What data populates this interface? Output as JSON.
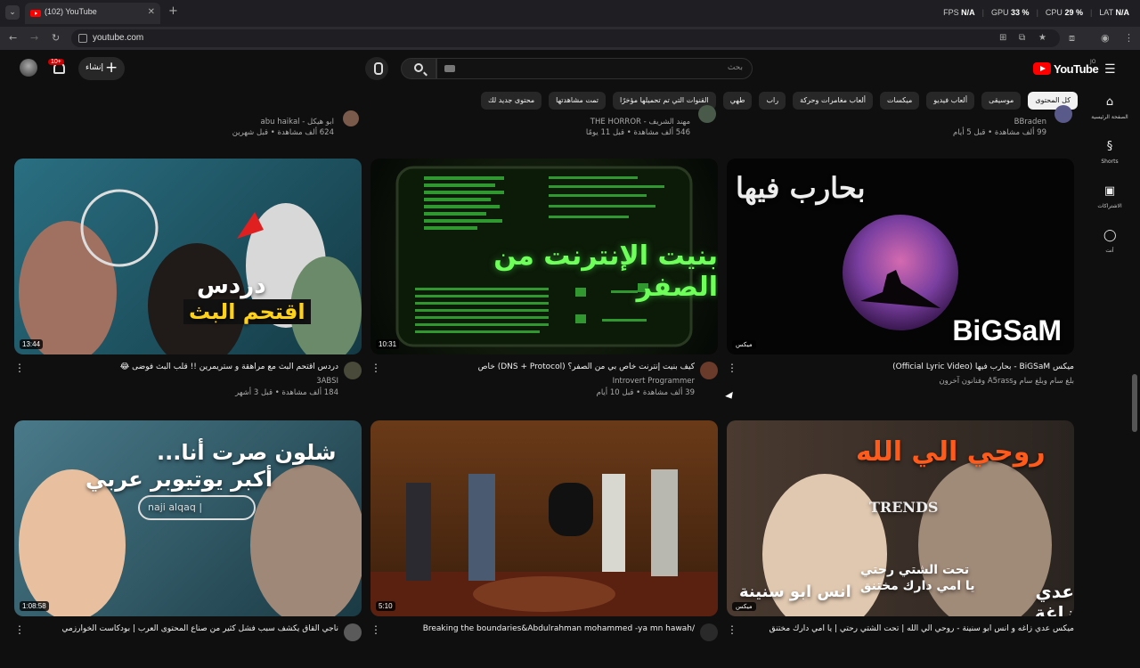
{
  "browser": {
    "tab_title": "(102) YouTube",
    "url": "youtube.com",
    "hud": {
      "fps_label": "FPS",
      "fps": "N/A",
      "gpu_label": "GPU",
      "gpu": "33 %",
      "cpu_label": "CPU",
      "cpu": "29 %",
      "lat_label": "LAT",
      "lat": "N/A"
    }
  },
  "header": {
    "logo_text": "YouTube",
    "logo_sup": "JO",
    "search_placeholder": "بحث",
    "create_label": "إنشاء",
    "notif_count": "10+"
  },
  "guide": [
    {
      "label": "الصفحة الرئيسية",
      "icon": "home-icon"
    },
    {
      "label": "Shorts",
      "icon": "shorts-icon"
    },
    {
      "label": "الاشتراكات",
      "icon": "subscriptions-icon"
    },
    {
      "label": "أنت",
      "icon": "you-icon"
    }
  ],
  "chips": [
    "كل المحتوى",
    "موسيقى",
    "ألعاب فيديو",
    "ميكسات",
    "ألعاب مغامرات وحركة",
    "راب",
    "طهي",
    "القنوات التي تم تحميلها مؤخرًا",
    "تمت مشاهدتها",
    "محتوى جديد لك"
  ],
  "top_row": [
    {
      "channel": "BBraden",
      "meta": "99 ألف مشاهدة • قبل 5 أيام"
    },
    {
      "channel": "مهند الشريف - THE HORROR",
      "meta": "546 ألف مشاهدة • قبل 11 يومًا"
    },
    {
      "channel": "ابو هيكل - abu haikal",
      "meta": "624 ألف مشاهدة • قبل شهرين"
    }
  ],
  "videos": [
    {
      "title": "ميكس BiGSaM - بحارب فيها (Official Lyric Video)",
      "channel": "بلغ سام وبلغ سام وA5rass وفنانون آخرون",
      "meta": "",
      "duration": "ميكس",
      "thumb_text": "بحارب فيها",
      "thumb_sub": "BiGSaM"
    },
    {
      "title": "كيف بنيت إنترنت خاص بي من الصفر؟ (DNS + Protocol) خاص",
      "channel": "Introvert Programmer",
      "meta": "39 ألف مشاهدة • قبل 10 أيام",
      "duration": "10:31",
      "thumb_text": "بنيت الإنترنت من الصفر"
    },
    {
      "title": "دردس اقتحم البث مع مراهقة و ستريمرين !! قلب البث فوضى 😂",
      "channel": "3ABSI",
      "meta": "184 ألف مشاهدة • قبل 3 أشهر",
      "duration": "13:44",
      "thumb_text": "دردس",
      "thumb_sub": "اقتحم البث"
    },
    {
      "title": "ميكس عدي زاغه و أنس ابو سنينة - روحي الي الله | تحت الشتي رحتي | يا امي دارك مختنق",
      "channel": "",
      "meta": "",
      "duration": "ميكس",
      "thumb_text": "روحي الي الله",
      "thumb_sub": "عدي زاغة",
      "thumb_sub2": "انس ابو سنينة",
      "thumb_sub3": "تحت الشتي رحتي",
      "thumb_sub4": "يا امي دارك مختنق",
      "thumb_sub5": "TRENDS"
    },
    {
      "title": "Breaking the boundaries&Abdulrahman mohammed -ya mn hawah/",
      "channel": "",
      "meta": "",
      "duration": "5:10"
    },
    {
      "title": "ناجي القاق يكشف سبب فشل كثير من صناع المحتوى العرب | بودكاست الخوارزمي",
      "channel": "",
      "meta": "",
      "duration": "1:08:58",
      "thumb_text": "شلون صرت أنا...",
      "thumb_sub": "أكبر يوتيوبر عربي",
      "thumb_sub2": "naji alqaq |"
    }
  ]
}
